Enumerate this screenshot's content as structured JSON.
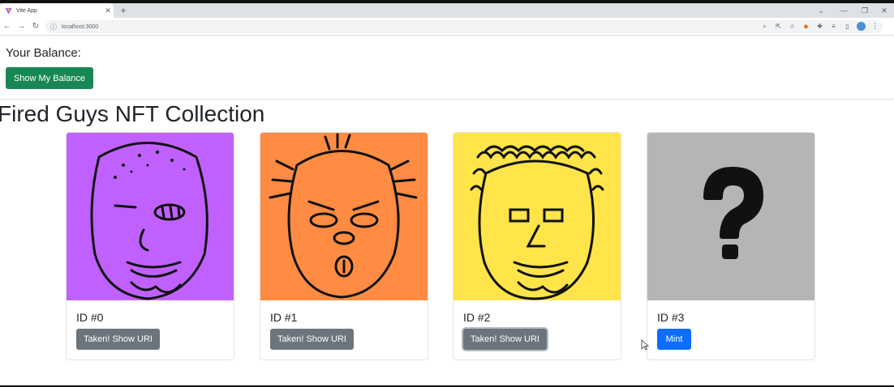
{
  "browser": {
    "tab_title": "Vite App",
    "tab_close_glyph": "✕",
    "new_tab_glyph": "+",
    "url": "localhost:3000",
    "window_controls": [
      "⌄",
      "—",
      "❐",
      "✕"
    ]
  },
  "page": {
    "balance_label": "Your Balance:",
    "show_balance_button": "Show My Balance",
    "collection_title": "Fired Guys NFT Collection"
  },
  "cards": [
    {
      "id_label": "ID #0",
      "button_label": "Taken! Show URI",
      "status": "taken",
      "bg_color": "#c061ff"
    },
    {
      "id_label": "ID #1",
      "button_label": "Taken! Show URI",
      "status": "taken",
      "bg_color": "#ff8c42"
    },
    {
      "id_label": "ID #2",
      "button_label": "Taken! Show URI",
      "status": "taken",
      "bg_color": "#ffe44a"
    },
    {
      "id_label": "ID #3",
      "button_label": "Mint",
      "status": "available",
      "bg_color": "#b5b5b5"
    }
  ],
  "colors": {
    "success": "#198754",
    "secondary": "#6c757d",
    "primary": "#0d6efd"
  }
}
